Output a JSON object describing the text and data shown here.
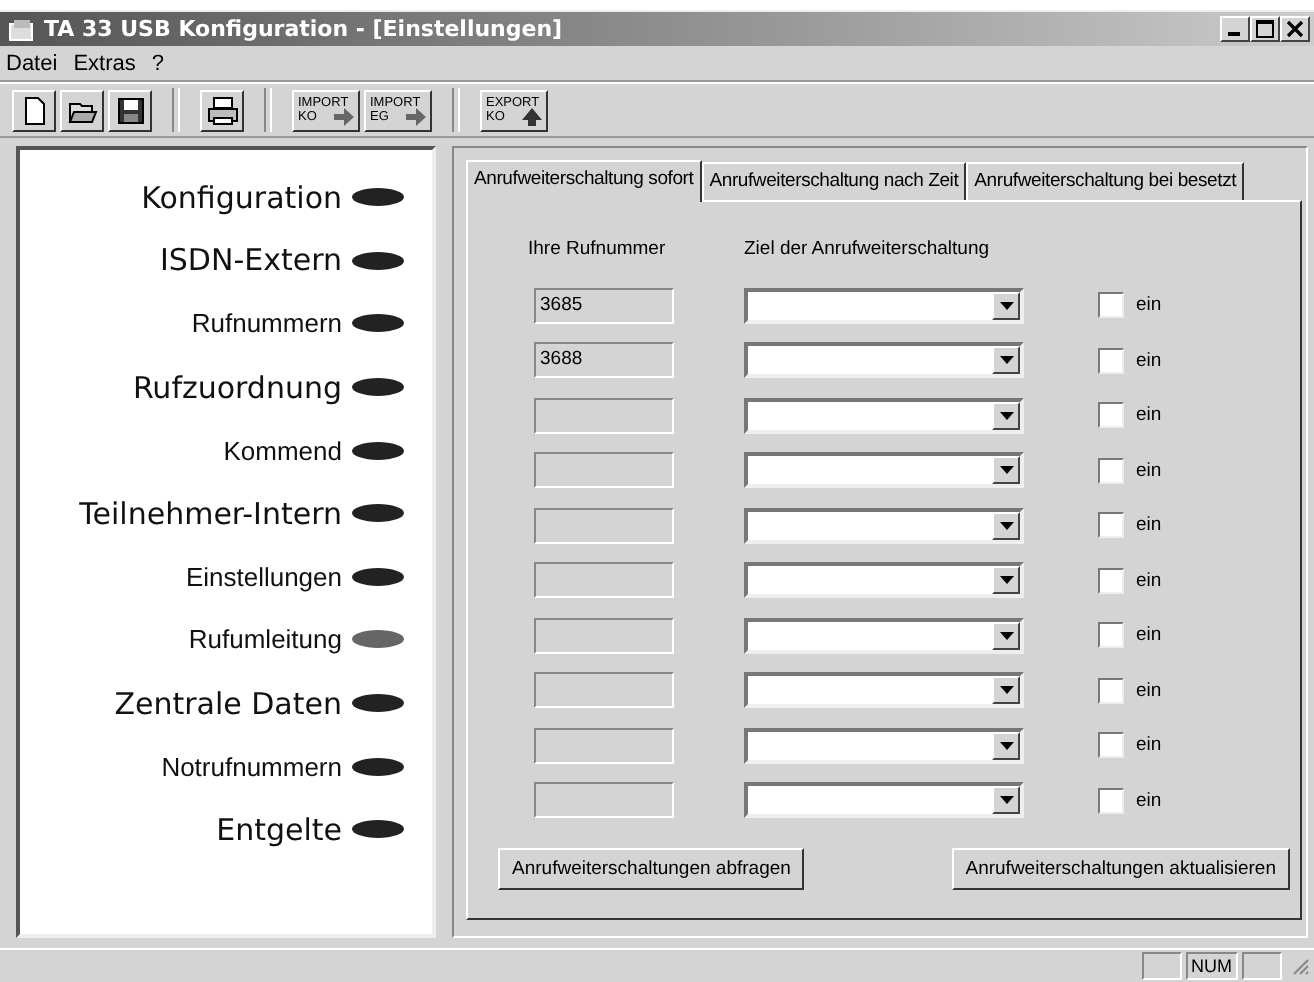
{
  "window": {
    "title": "TA 33 USB Konfiguration - [Einstellungen]"
  },
  "menu": [
    "Datei",
    "Extras",
    "?"
  ],
  "toolbar": [
    {
      "kind": "new"
    },
    {
      "kind": "open"
    },
    {
      "kind": "save"
    },
    {
      "kind": "print"
    },
    {
      "kind": "import",
      "lines": [
        "IMPORT",
        "KO"
      ]
    },
    {
      "kind": "import",
      "lines": [
        "IMPORT",
        "EG"
      ]
    },
    {
      "kind": "export",
      "lines": [
        "EXPORT",
        "KO"
      ]
    }
  ],
  "sidebar": {
    "items": [
      {
        "label": "Konfiguration",
        "kind": "major",
        "selected": false
      },
      {
        "label": "ISDN-Extern",
        "kind": "major",
        "selected": false
      },
      {
        "label": "Rufnummern",
        "kind": "minor",
        "selected": false
      },
      {
        "label": "Rufzuordnung",
        "kind": "major",
        "selected": false
      },
      {
        "label": "Kommend",
        "kind": "minor",
        "selected": false
      },
      {
        "label": "Teilnehmer-Intern",
        "kind": "major",
        "selected": false
      },
      {
        "label": "Einstellungen",
        "kind": "minor",
        "selected": false
      },
      {
        "label": "Rufumleitung",
        "kind": "minor",
        "selected": true
      },
      {
        "label": "Zentrale Daten",
        "kind": "major",
        "selected": false
      },
      {
        "label": "Notrufnummern",
        "kind": "minor",
        "selected": false
      },
      {
        "label": "Entgelte",
        "kind": "major",
        "selected": false
      }
    ]
  },
  "tabs": [
    {
      "label": "Anrufweiterschaltung sofort",
      "selected": true
    },
    {
      "label": "Anrufweiterschaltung nach Zeit",
      "selected": false
    },
    {
      "label": "Anrufweiterschaltung bei besetzt",
      "selected": false
    }
  ],
  "columns": [
    "Ihre Rufnummer",
    "Ziel der Anrufweiterschaltung"
  ],
  "rows": [
    {
      "number": "3685",
      "checkbox_label": "ein",
      "checked": false
    },
    {
      "number": "3688",
      "checkbox_label": "ein",
      "checked": false
    },
    {
      "checkbox_label": "ein",
      "checked": false
    },
    {
      "checkbox_label": "ein",
      "checked": false
    },
    {
      "checkbox_label": "ein",
      "checked": false
    },
    {
      "checkbox_label": "ein",
      "checked": false
    },
    {
      "checkbox_label": "ein",
      "checked": false
    },
    {
      "checkbox_label": "ein",
      "checked": false
    },
    {
      "checkbox_label": "ein",
      "checked": false
    },
    {
      "checkbox_label": "ein",
      "checked": false
    }
  ],
  "buttons": [
    "Anrufweiterschaltungen abfragen",
    "Anrufweiterschaltungen aktualisieren"
  ],
  "status_bar": {
    "panels": [
      {
        "kind": "blank"
      },
      {
        "kind": "text",
        "text": "NUM"
      },
      {
        "kind": "blank"
      }
    ]
  }
}
